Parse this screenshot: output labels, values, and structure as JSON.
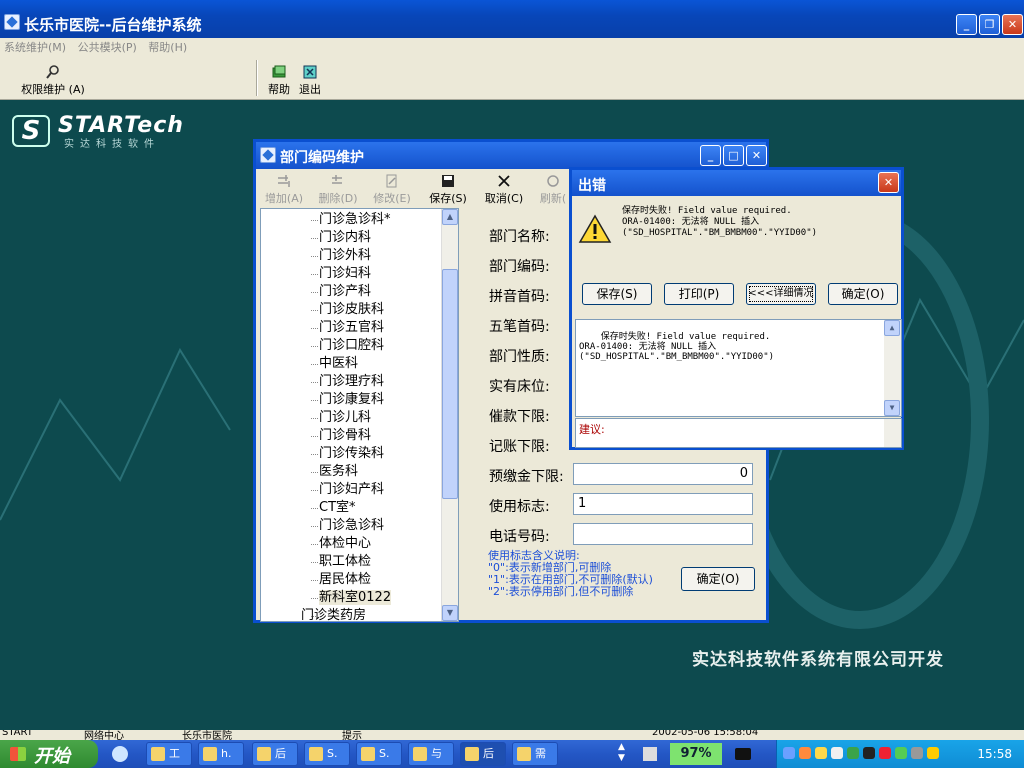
{
  "main_window": {
    "title": "长乐市医院--后台维护系统"
  },
  "menu": [
    "系统维护(M)",
    "公共模块(P)",
    "帮助(H)"
  ],
  "toolbar": {
    "perm": "权限维护 (A)",
    "help": "帮助",
    "exit": "退出"
  },
  "logo": {
    "brand": "STARTech",
    "subtitle": "实达科技软件"
  },
  "company_footer": "实达科技软件系统有限公司开发",
  "dept_dialog": {
    "title": "部门编码维护",
    "toolbar": {
      "add": "增加(A)",
      "delete": "删除(D)",
      "modify": "修改(E)",
      "save": "保存(S)",
      "cancel": "取消(C)",
      "refresh": "刷新("
    },
    "tree_items": [
      "门诊急诊科*",
      "门诊内科",
      "门诊外科",
      "门诊妇科",
      "门诊产科",
      "门诊皮肤科",
      "门诊五官科",
      "门诊口腔科",
      "中医科",
      "门诊理疗科",
      "门诊康复科",
      "门诊儿科",
      "门诊骨科",
      "门诊传染科",
      "医务科",
      "门诊妇产科",
      "CT室*",
      "门诊急诊科",
      "体检中心",
      "职工体检",
      "居民体检",
      "新科室0122",
      "门诊类药房"
    ],
    "form": {
      "name_label": "部门名称:",
      "code_label": "部门编码:",
      "pinyin_label": "拼音首码:",
      "wubi_label": "五笔首码:",
      "nature_label": "部门性质:",
      "beds_label": "实有床位:",
      "urge_label": "催款下限:",
      "charge_label": "记账下限:",
      "prepay_label": "预缴金下限:",
      "prepay_value": "0",
      "use_label": "使用标志:",
      "use_value": "1",
      "phone_label": "电话号码:",
      "phone_value": ""
    },
    "legend": [
      "使用标志含义说明:",
      "\"0\":表示新增部门,可删除",
      "\"1\":表示在用部门,不可删除(默认)",
      "\"2\":表示停用部门,但不可删除"
    ],
    "ok_button": "确定(O)"
  },
  "error_dialog": {
    "title": "出错",
    "message": "保存时失败! Field value required.\nORA-01400: 无法将 NULL 插入\n(\"SD_HOSPITAL\".\"BM_BMBM00\".\"YYID00\")",
    "buttons": {
      "save": "保存(S)",
      "print": "打印(P)",
      "details": "<<<详细情况",
      "ok": "确定(O)"
    },
    "detail_text": "保存时失败! Field value required.\nORA-01400: 无法将 NULL 插入\n(\"SD_HOSPITAL\".\"BM_BMBM00\".\"YYID00\")",
    "suggestion_label": "建议:"
  },
  "status_bar": [
    "START",
    "网络中心",
    "长乐市医院",
    "提示",
    "2002-05-06 15:58:04"
  ],
  "taskbar": {
    "start": "开始",
    "buttons": [
      "工",
      "h.",
      "后",
      "S.",
      "S.",
      "与",
      "后",
      "需"
    ],
    "battery": "97%",
    "clock": "15:58"
  },
  "colors": {
    "desktop": "#0d4a4e",
    "titlebar": "#0a55d6",
    "close": "#c9381a",
    "legend_text": "#1d4fd7"
  }
}
